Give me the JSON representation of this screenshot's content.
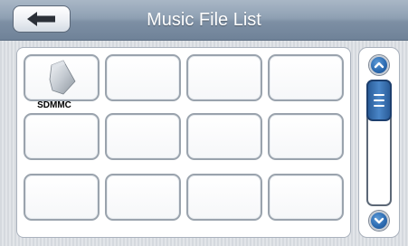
{
  "header": {
    "title": "Music File List",
    "back_icon": "left-arrow-icon"
  },
  "grid": {
    "items": [
      {
        "label": "SDMMC",
        "icon": "sd-card-icon"
      },
      {
        "label": ""
      },
      {
        "label": ""
      },
      {
        "label": ""
      },
      {
        "label": ""
      },
      {
        "label": ""
      },
      {
        "label": ""
      },
      {
        "label": ""
      },
      {
        "label": ""
      },
      {
        "label": ""
      },
      {
        "label": ""
      },
      {
        "label": ""
      }
    ]
  },
  "scrollbar": {
    "up_icon": "chevron-up-icon",
    "down_icon": "chevron-down-icon",
    "thumb_icon": "grip-lines-icon",
    "position": 0
  },
  "colors": {
    "header": "#8fa0b3",
    "accent": "#2d6cb2",
    "tile_border": "#9aa3ad"
  }
}
